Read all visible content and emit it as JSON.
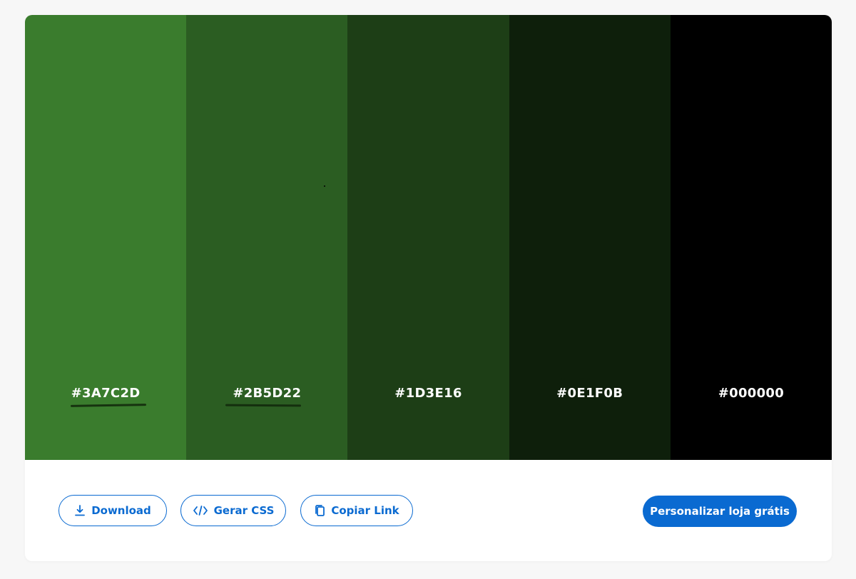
{
  "palette": {
    "colors": [
      {
        "hex": "#3A7C2D",
        "color": "#3A7C2D"
      },
      {
        "hex": "#2B5D22",
        "color": "#2B5D22"
      },
      {
        "hex": "#1D3E16",
        "color": "#1D3E16"
      },
      {
        "hex": "#0E1F0B",
        "color": "#0E1F0B"
      },
      {
        "hex": "#000000",
        "color": "#000000"
      }
    ]
  },
  "actions": {
    "download_label": "Download",
    "css_label": "Gerar CSS",
    "link_label": "Copiar Link",
    "primary_label": "Personalizar loja grátis"
  },
  "icons": {
    "download": "download-icon",
    "css": "code-icon",
    "link": "copy-icon"
  },
  "colors": {
    "accent": "#0A6AD1",
    "background": "#F7F7F7",
    "card": "#FFFFFF"
  }
}
